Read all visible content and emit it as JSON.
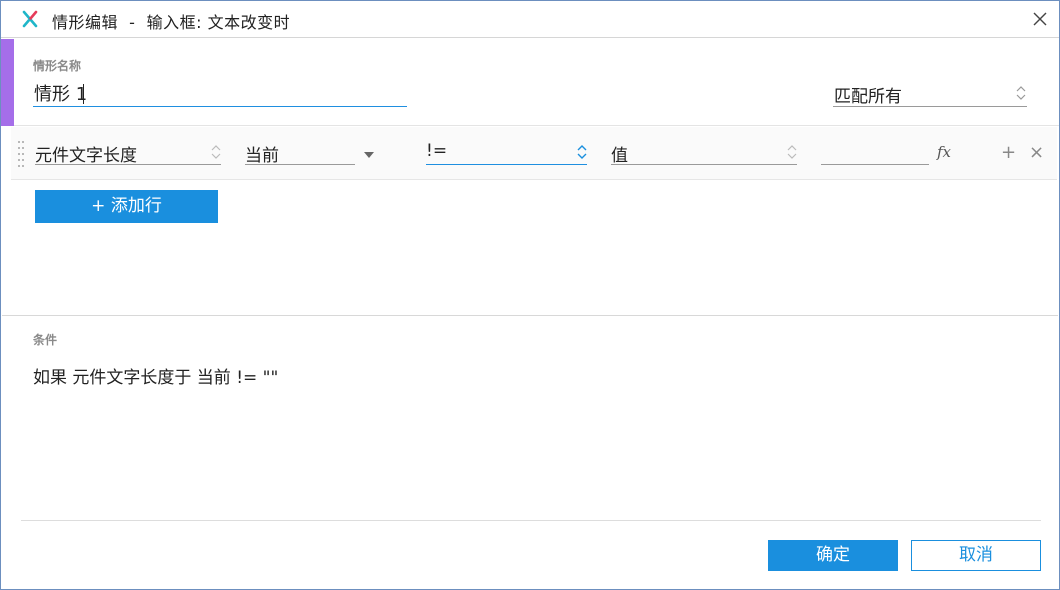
{
  "window": {
    "title": "情形编辑  -  输入框: 文本改变时"
  },
  "case_name": {
    "label": "情形名称",
    "value": "情形 1",
    "match_option": "匹配所有"
  },
  "condition_row": {
    "target": "元件文字长度",
    "object": "当前",
    "operator": "!=",
    "value_type": "值",
    "value": "",
    "fx_label": "fx",
    "add_icon": "+",
    "remove_icon": "×"
  },
  "add_row_button": "+ 添加行",
  "conditions": {
    "label": "条件",
    "text": "如果 元件文字长度于 当前 != \"\""
  },
  "footer": {
    "ok_label": "确定",
    "cancel_label": "取消"
  },
  "colors": {
    "accent_purple": "#a56ee9",
    "primary_blue": "#1a8fde",
    "logo_teal": "#1fb6c9",
    "logo_red": "#e63c5a"
  },
  "icons": {
    "logo": "axure-x-logo",
    "close": "close-icon",
    "grip": "drag-handle-icon",
    "spinner": "updown-chevron-icon",
    "dropdown": "caret-down-icon"
  }
}
